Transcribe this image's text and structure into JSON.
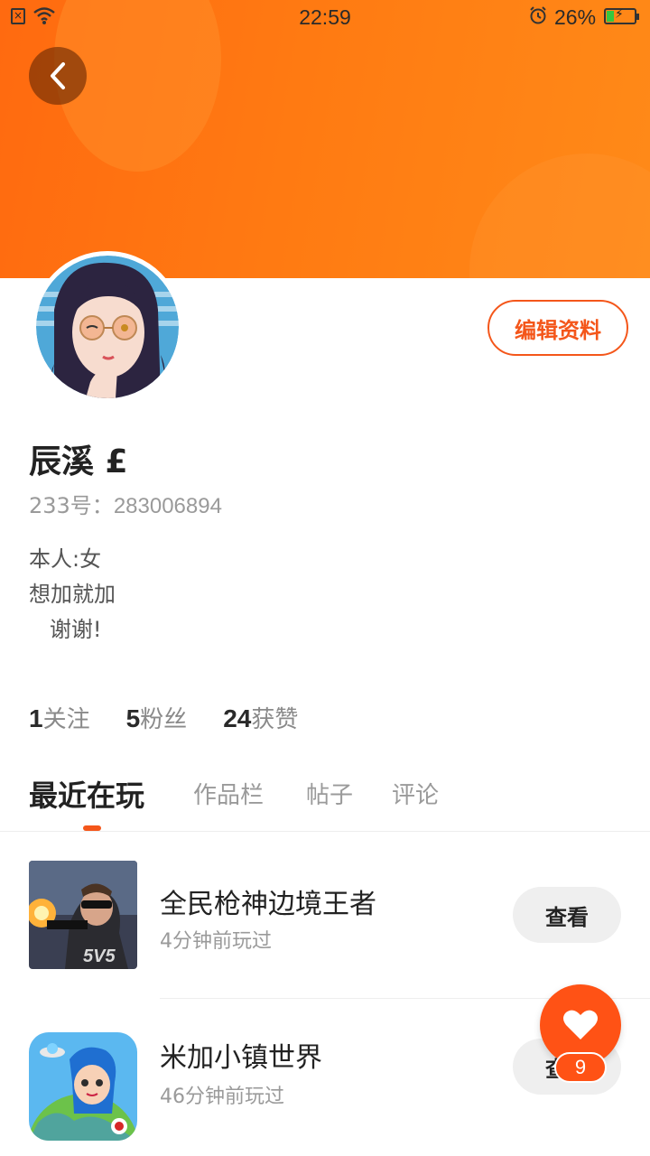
{
  "status_bar": {
    "time": "22:59",
    "battery_percent": "26%",
    "battery_level": 0.26,
    "icons": [
      "sim-card-icon",
      "wifi-icon",
      "alarm-icon",
      "battery-icon"
    ]
  },
  "header": {
    "back_icon": "chevron-left-icon",
    "edit_label": "编辑资料"
  },
  "profile": {
    "nickname": "辰溪 £",
    "id_label": "233号：",
    "id_value": "283006894",
    "bio": "本人:女\n想加就加\n   谢谢!"
  },
  "stats": [
    {
      "value": "1",
      "label": "关注"
    },
    {
      "value": "5",
      "label": "粉丝"
    },
    {
      "value": "24",
      "label": "获赞"
    }
  ],
  "tabs": [
    {
      "label": "最近在玩",
      "active": true
    },
    {
      "label": "作品栏",
      "active": false
    },
    {
      "label": "帖子",
      "active": false
    },
    {
      "label": "评论",
      "active": false
    }
  ],
  "games": [
    {
      "name": "全民枪神边境王者",
      "played": "4分钟前玩过",
      "button": "查看"
    },
    {
      "name": "米加小镇世界",
      "played": "46分钟前玩过",
      "button": "查看"
    }
  ],
  "fab": {
    "icon": "heart-icon",
    "badge": "9"
  },
  "colors": {
    "accent": "#f4561a",
    "header": "#ff7a12"
  }
}
